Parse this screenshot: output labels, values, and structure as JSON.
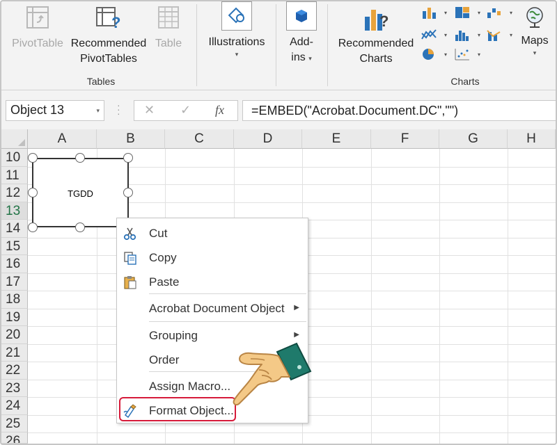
{
  "ribbon": {
    "tables": {
      "pivottable": "PivotTable",
      "recommended_pivot_line1": "Recommended",
      "recommended_pivot_line2": "PivotTables",
      "table": "Table",
      "group_label": "Tables"
    },
    "illustrations": {
      "label": "Illustrations"
    },
    "addins": {
      "label_line1": "Add-",
      "label_line2": "ins"
    },
    "charts": {
      "recommended_line1": "Recommended",
      "recommended_line2": "Charts",
      "maps": "Maps",
      "group_label": "Charts"
    }
  },
  "formula_bar": {
    "name_box": "Object 13",
    "cancel_icon": "✕",
    "enter_icon": "✓",
    "fx": "fx",
    "formula": "=EMBED(\"Acrobat.Document.DC\",\"\")"
  },
  "grid": {
    "columns": [
      "A",
      "B",
      "C",
      "D",
      "E",
      "F",
      "G",
      "H"
    ],
    "rows": [
      "10",
      "11",
      "12",
      "13",
      "14",
      "15",
      "16",
      "17",
      "18",
      "19",
      "20",
      "21",
      "22",
      "23",
      "24",
      "25",
      "26"
    ],
    "active_row": "13"
  },
  "embedded_object": {
    "text": "TGDD"
  },
  "context_menu": {
    "cut": "Cut",
    "copy": "Copy",
    "paste": "Paste",
    "acrobat": "Acrobat Document Object",
    "grouping": "Grouping",
    "order": "Order",
    "assign_macro": "Assign Macro...",
    "format_object": "Format Object..."
  },
  "colors": {
    "highlight": "#d61a3a",
    "accent": "#217346"
  }
}
